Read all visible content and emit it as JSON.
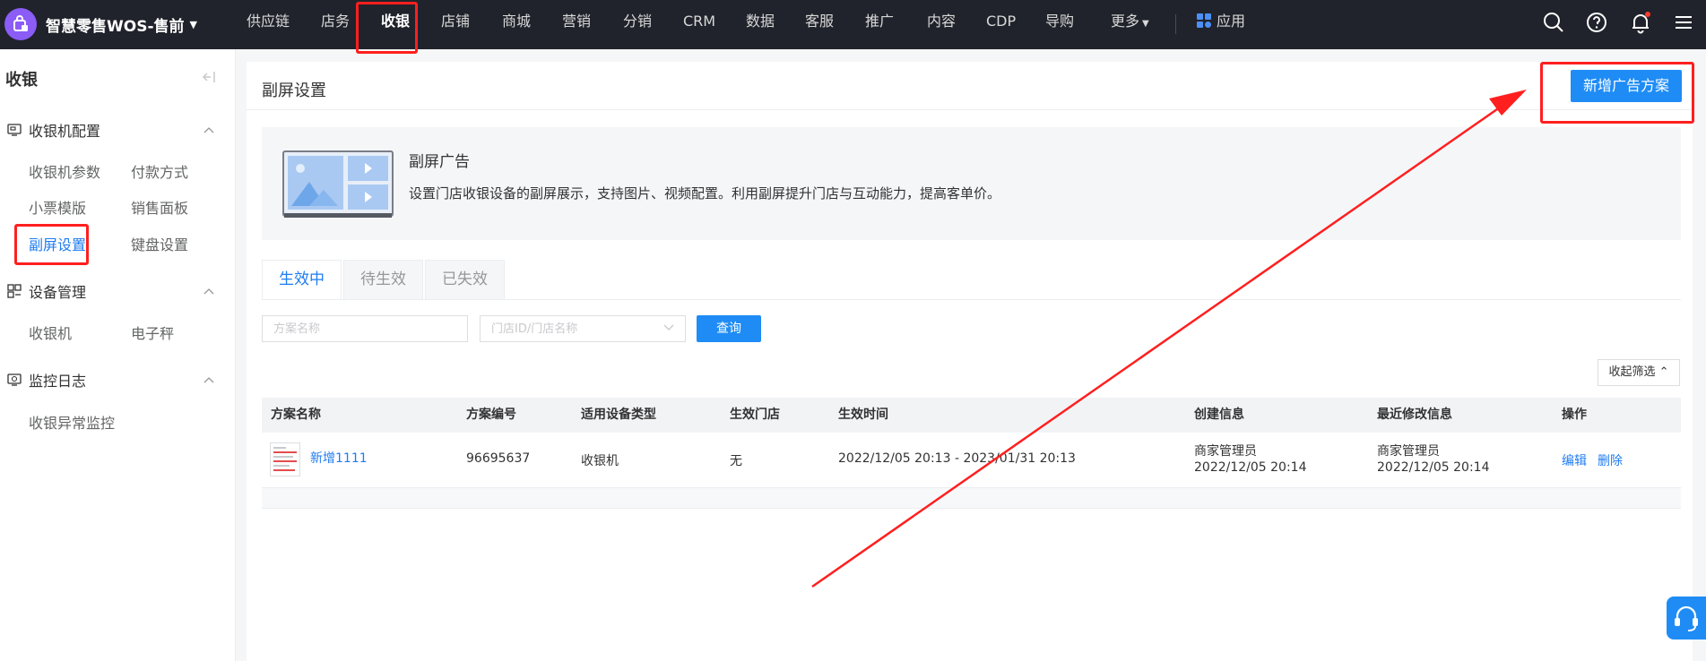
{
  "brand": {
    "name": "智慧零售WOS-售前",
    "logo_icon": "bag-icon"
  },
  "nav": {
    "items": [
      "供应链",
      "店务",
      "收银",
      "店铺",
      "商城",
      "营销",
      "分销",
      "CRM",
      "数据",
      "客服",
      "推广",
      "内容",
      "CDP",
      "导购",
      "更多"
    ],
    "active": "收银",
    "apps_label": "应用"
  },
  "sidebar": {
    "title": "收银",
    "groups": [
      {
        "label": "收银机配置",
        "icon": "register-config-icon",
        "items": [
          "收银机参数",
          "付款方式",
          "小票模版",
          "销售面板",
          "副屏设置",
          "键盘设置"
        ]
      },
      {
        "label": "设备管理",
        "icon": "device-icon",
        "items": [
          "收银机",
          "电子秤"
        ]
      },
      {
        "label": "监控日志",
        "icon": "monitor-icon",
        "items": [
          "收银异常监控"
        ]
      }
    ],
    "active_item": "副屏设置"
  },
  "page": {
    "title": "副屏设置",
    "add_button": "新增广告方案"
  },
  "intro": {
    "title": "副屏广告",
    "desc": "设置门店收银设备的副屏展示，支持图片、视频配置。利用副屏提升门店与互动能力，提高客单价。"
  },
  "tabs": [
    "生效中",
    "待生效",
    "已失效"
  ],
  "filters": {
    "name_placeholder": "方案名称",
    "store_placeholder": "门店ID/门店名称",
    "query_button": "查询",
    "collapse_button": "收起筛选 ⌃"
  },
  "table": {
    "columns": [
      "方案名称",
      "方案编号",
      "适用设备类型",
      "生效门店",
      "生效时间",
      "创建信息",
      "最近修改信息",
      "操作"
    ],
    "rows": [
      {
        "name": "新增1111",
        "code": "96695637",
        "device": "收银机",
        "stores": "无",
        "time": "2022/12/05 20:13 - 2023/01/31 20:13",
        "creator": "商家管理员",
        "created_at": "2022/12/05 20:14",
        "modifier": "商家管理员",
        "modified_at": "2022/12/05 20:14",
        "actions": [
          "编辑",
          "删除"
        ]
      }
    ]
  },
  "colors": {
    "primary": "#1f8cf5",
    "topbar": "#20232b",
    "highlight": "#ff1f1f"
  }
}
